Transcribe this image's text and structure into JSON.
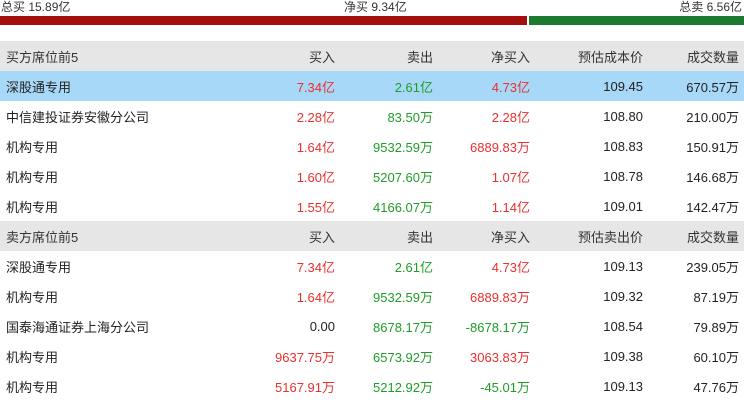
{
  "summary": {
    "total_buy": "总买 15.89亿",
    "net_buy": "净买 9.34亿",
    "total_sell": "总卖 6.56亿",
    "buy_share": 0.708,
    "buy_color": "#a30f0f",
    "sell_color": "#1b7a2f"
  },
  "colors": {
    "up": "#e8312f",
    "down": "#1f9d28",
    "highlight": "#a8d8f7",
    "header": "#e6e6e6"
  },
  "buy_table": {
    "headers": [
      "买方席位前5",
      "买入",
      "卖出",
      "净买入",
      "预估成本价",
      "成交数量"
    ],
    "rows": [
      {
        "name": "深股通专用",
        "buy": "7.34亿",
        "sell": "2.61亿",
        "net": "4.73亿",
        "price": "109.45",
        "volume": "670.57万",
        "net_color": "red",
        "highlight": true
      },
      {
        "name": "中信建投证券安徽分公司",
        "buy": "2.28亿",
        "sell": "83.50万",
        "net": "2.28亿",
        "price": "108.80",
        "volume": "210.00万",
        "net_color": "red",
        "highlight": false
      },
      {
        "name": "机构专用",
        "buy": "1.64亿",
        "sell": "9532.59万",
        "net": "6889.83万",
        "price": "108.83",
        "volume": "150.91万",
        "net_color": "red",
        "highlight": false
      },
      {
        "name": "机构专用",
        "buy": "1.60亿",
        "sell": "5207.60万",
        "net": "1.07亿",
        "price": "108.78",
        "volume": "146.68万",
        "net_color": "red",
        "highlight": false
      },
      {
        "name": "机构专用",
        "buy": "1.55亿",
        "sell": "4166.07万",
        "net": "1.14亿",
        "price": "109.01",
        "volume": "142.47万",
        "net_color": "red",
        "highlight": false
      }
    ]
  },
  "sell_table": {
    "headers": [
      "卖方席位前5",
      "买入",
      "卖出",
      "净买入",
      "预估卖出价",
      "成交数量"
    ],
    "rows": [
      {
        "name": "深股通专用",
        "buy": "7.34亿",
        "sell": "2.61亿",
        "net": "4.73亿",
        "price": "109.13",
        "volume": "239.05万",
        "buy_color": "red",
        "net_color": "red"
      },
      {
        "name": "机构专用",
        "buy": "1.64亿",
        "sell": "9532.59万",
        "net": "6889.83万",
        "price": "109.32",
        "volume": "87.19万",
        "buy_color": "red",
        "net_color": "red"
      },
      {
        "name": "国泰海通证券上海分公司",
        "buy": "0.00",
        "sell": "8678.17万",
        "net": "-8678.17万",
        "price": "108.54",
        "volume": "79.89万",
        "buy_color": "black",
        "net_color": "green"
      },
      {
        "name": "机构专用",
        "buy": "9637.75万",
        "sell": "6573.92万",
        "net": "3063.83万",
        "price": "109.38",
        "volume": "60.10万",
        "buy_color": "red",
        "net_color": "red"
      },
      {
        "name": "机构专用",
        "buy": "5167.91万",
        "sell": "5212.92万",
        "net": "-45.01万",
        "price": "109.13",
        "volume": "47.76万",
        "buy_color": "red",
        "net_color": "green"
      }
    ]
  }
}
